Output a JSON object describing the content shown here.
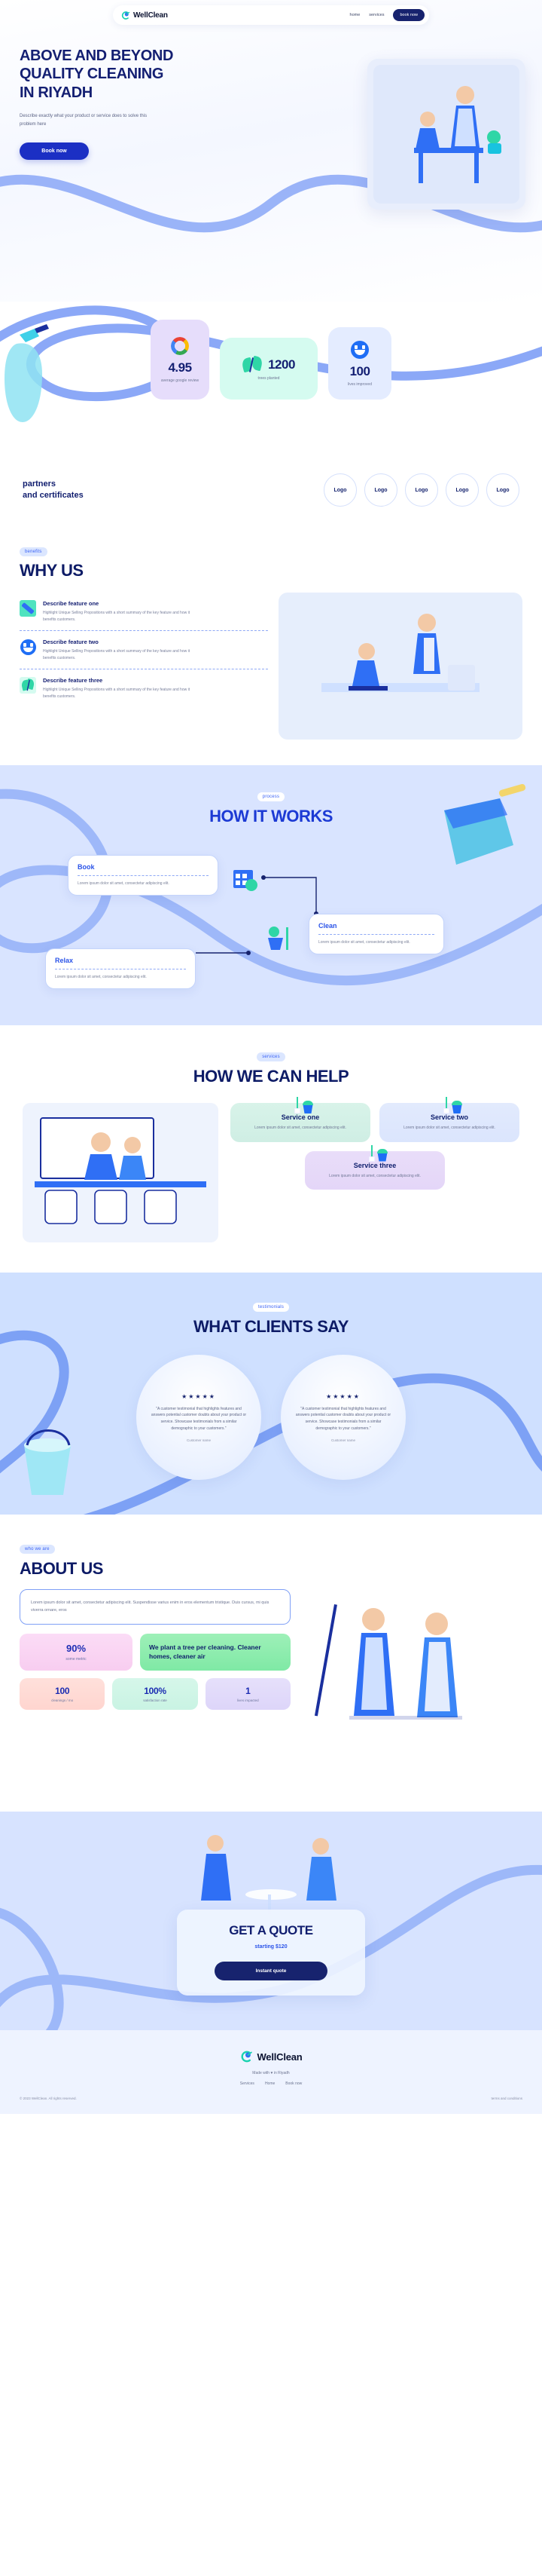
{
  "brand": {
    "name": "WellClean",
    "logo_icon": "wellclean-swirl-logo"
  },
  "nav": {
    "links": [
      {
        "label": "home"
      },
      {
        "label": "services"
      }
    ],
    "cta_label": "book now"
  },
  "hero": {
    "title_lines": [
      "ABOVE AND BEYOND",
      "QUALITY CLEANING",
      "IN RIYADH"
    ],
    "subtitle": "Describe exactly what your product or service does to solve this problem here",
    "cta_label": "Book now",
    "art_alt": "illustration-cleaners-at-work"
  },
  "stats": {
    "cards": [
      {
        "icon": "google-g-icon",
        "value": "4.95",
        "label": "average google review"
      },
      {
        "icon": "leaf-icon",
        "value": "1200",
        "label": "trees planted"
      },
      {
        "icon": "smiley-icon",
        "value": "100",
        "label": "lives improved"
      }
    ]
  },
  "partners": {
    "title_lines": [
      "partners",
      "and certificates"
    ],
    "logos": [
      {
        "label": "Logo"
      },
      {
        "label": "Logo"
      },
      {
        "label": "Logo"
      },
      {
        "label": "Logo"
      },
      {
        "label": "Logo"
      }
    ]
  },
  "whyus": {
    "badge": "benefits",
    "title": "WHY US",
    "features": [
      {
        "icon": "brush-icon",
        "title": "Describe feature one",
        "desc": "Highlight Unique Selling Propositions with a short summary of the key feature and how it benefits customers."
      },
      {
        "icon": "smiley-icon",
        "title": "Describe feature two",
        "desc": "Highlight Unique Selling Propositions with a short summary of the key feature and how it benefits customers."
      },
      {
        "icon": "leaf-icon",
        "title": "Describe feature three",
        "desc": "Highlight Unique Selling Propositions with a short summary of the key feature and how it benefits customers."
      }
    ]
  },
  "how": {
    "badge": "process",
    "title": "HOW IT WORKS",
    "steps": [
      {
        "title": "Book",
        "desc": "Lorem ipsum dolor sit amet, consectetur adipiscing elit.",
        "icon": "calendar-clock-icon"
      },
      {
        "title": "Clean",
        "desc": "Lorem ipsum dolor sit amet, consectetur adipiscing elit.",
        "icon": "bucket-mop-icon"
      },
      {
        "title": "Relax",
        "desc": "Lorem ipsum dolor sit amet, consectetur adipiscing elit.",
        "icon": "sofa-icon"
      }
    ]
  },
  "services": {
    "badge": "services",
    "title": "HOW WE CAN HELP",
    "art_alt": "illustration-office-cleaning",
    "cards": [
      {
        "icon": "bucket-mop-icon",
        "title": "Service one",
        "desc": "Lorem ipsum dolor sit amet, consectetur adipiscing elit."
      },
      {
        "icon": "bucket-mop-icon",
        "title": "Service two",
        "desc": "Lorem ipsum dolor sit amet, consectetur adipiscing elit."
      },
      {
        "icon": "bucket-mop-icon",
        "title": "Service three",
        "desc": "Lorem ipsum dolor sit amet, consectetur adipiscing elit."
      }
    ]
  },
  "testimonials": {
    "badge": "testimonials",
    "title": "WHAT CLIENTS SAY",
    "items": [
      {
        "stars": "★★★★★",
        "text": "\"A customer testimonial that highlights features and answers potential customer doubts about your product or service. Showcase testimonials from a similar demographic to your customers.\"",
        "name": "Customer name"
      },
      {
        "stars": "★★★★★",
        "text": "\"A customer testimonial that highlights features and answers potential customer doubts about your product or service. Showcase testimonials from a similar demographic to your customers.\"",
        "name": "Customer name"
      }
    ]
  },
  "about": {
    "badge": "who we are",
    "title": "ABOUT US",
    "body": "Lorem ipsum dolor sit amet, consectetur adipiscing elit. Suspendisse varius enim in eros elementum tristique. Duis cursus, mi quis viverra ornare, eros",
    "tile_percent": {
      "value": "90%",
      "label": "some metric"
    },
    "tile_eco": "We plant a tree per cleaning. Cleaner homes, cleaner air",
    "metrics": [
      {
        "value": "100",
        "label": "cleanings / mo"
      },
      {
        "value": "100%",
        "label": "satisfaction rate"
      },
      {
        "value": "1",
        "label": "lives impacted"
      }
    ],
    "art_alt": "illustration-two-cleaners"
  },
  "quote": {
    "title": "GET A QUOTE",
    "price": "starting $120",
    "cta_label": "Instant quote"
  },
  "footer": {
    "brand": "WellClean",
    "made_with": "Made with ♥ in Riyadh",
    "links": [
      {
        "label": "Services"
      },
      {
        "label": "Home"
      },
      {
        "label": "Book now"
      }
    ],
    "copyright": "© 2023 WellClean. All rights reserved.",
    "terms": "terms and conditions"
  },
  "colors": {
    "navy": "#101d6e",
    "blue": "#1b2fc4",
    "accent_blue": "#2a53e8",
    "mint": "#2fd6a6",
    "lavender": "#e6ddfb",
    "page_blue": "#d9e4ff"
  }
}
